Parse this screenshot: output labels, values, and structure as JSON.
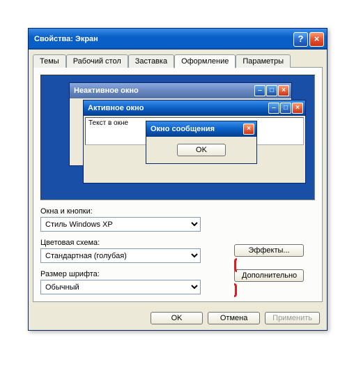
{
  "dialog": {
    "title": "Свойства: Экран",
    "help": "?",
    "close": "×"
  },
  "tabs": {
    "themes": "Темы",
    "desktop": "Рабочий стол",
    "screensaver": "Заставка",
    "appearance": "Оформление",
    "settings": "Параметры"
  },
  "preview": {
    "inactive_title": "Неактивное окно",
    "active_title": "Активное окно",
    "window_text": "Текст в окне",
    "msg_title": "Окно сообщения",
    "msg_ok": "OK",
    "min": "–",
    "max": "□",
    "close": "×"
  },
  "form": {
    "windows_buttons_label": "Окна и кнопки:",
    "windows_buttons_value": "Стиль Windows XP",
    "color_scheme_label": "Цветовая схема:",
    "color_scheme_value": "Стандартная (голубая)",
    "font_size_label": "Размер шрифта:",
    "font_size_value": "Обычный",
    "effects": "Эффекты...",
    "advanced": "Дополнительно"
  },
  "buttons": {
    "ok": "OK",
    "cancel": "Отмена",
    "apply": "Применить"
  }
}
